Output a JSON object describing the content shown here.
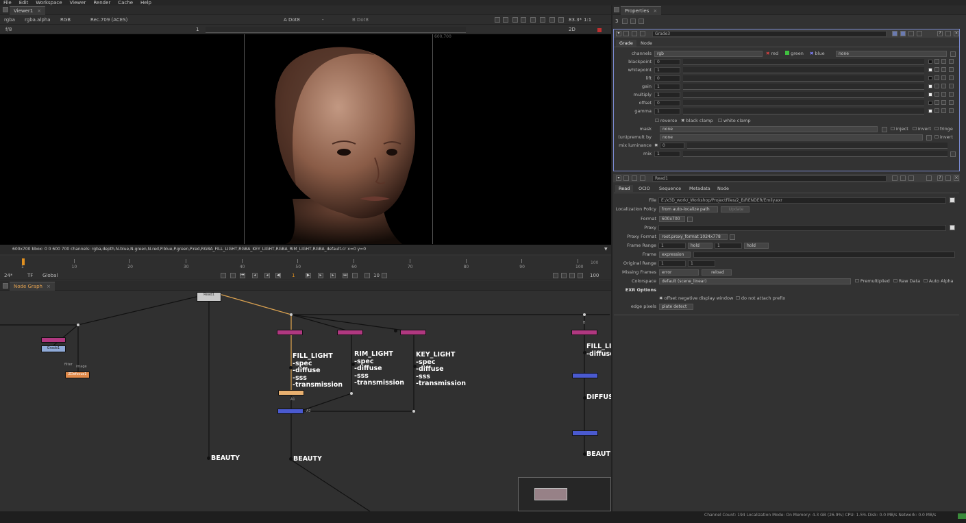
{
  "menu": [
    "File",
    "Edit",
    "Workspace",
    "Viewer",
    "Render",
    "Cache",
    "Help"
  ],
  "viewer": {
    "tab": "Viewer1",
    "layer": "rgba",
    "alpha": "rgba.alpha",
    "mode": "RGB",
    "colorspace": "Rec.709 (ACES)",
    "a_input": "A  Dot8",
    "a_dash": "-",
    "b_input": "B  Dot8",
    "zoom": "83.3*",
    "ratio": "1:1",
    "view": "2D",
    "fstop": "f/8",
    "frame": "1",
    "res_label": "600,700",
    "status": "600x700  bbox: 0 0 600 700 channels: rgba,depth,N.blue,N.green,N.red,P.blue,P.green,P.red,RGBA_FILL_LIGHT,RGBA_KEY_LIGHT,RGBA_RIM_LIGHT,RGBA_default.cr  x=0 y=0"
  },
  "timeline": {
    "ticks": [
      "1",
      "10",
      "20",
      "30",
      "40",
      "50",
      "60",
      "70",
      "80",
      "90",
      "100"
    ],
    "end": "100",
    "fps": "24*",
    "tf": "TF",
    "global": "Global",
    "current_frame": "1",
    "step": "10",
    "last": "100"
  },
  "nodegraph": {
    "tab": "Node Graph",
    "read_node": "Read1",
    "grade_node": "Grade1",
    "zdefocus": "ZDefocus1",
    "filter_label": "filter",
    "image_label": "image",
    "label_b": "B",
    "label_a1": "A1",
    "label_a2": "A2",
    "fill": "FILL_LIGHT\n-spec\n-diffuse\n-sss\n-transmission",
    "rim": "RIM_LIGHT\n-spec\n-diffuse\n-sss\n-transmission",
    "key": "KEY_LIGHT\n-spec\n-diffuse\n-sss\n-transmission",
    "fill_right": "FILL_LI\n-diffuse",
    "diffuse_right": "DIFFUS",
    "beauty1": "BEAUTY",
    "beauty2": "BEAUTY",
    "beauty3": "BEAUT"
  },
  "properties": {
    "tab": "Properties",
    "count": "3",
    "grade": {
      "name": "Grade3",
      "tabs": [
        "Grade",
        "Node"
      ],
      "channels": "rgb",
      "red": "red",
      "green": "green",
      "blue": "blue",
      "none": "none",
      "rows": [
        {
          "label": "blackpoint",
          "value": "0"
        },
        {
          "label": "whitepoint",
          "value": "1"
        },
        {
          "label": "lift",
          "value": "0"
        },
        {
          "label": "gain",
          "value": "1"
        },
        {
          "label": "multiply",
          "value": "1"
        },
        {
          "label": "offset",
          "value": "0"
        },
        {
          "label": "gamma",
          "value": "1"
        }
      ],
      "reverse": "reverse",
      "black_clamp": "black clamp",
      "white_clamp": "white clamp",
      "mask_label": "mask",
      "mask_value": "none",
      "inject": "inject",
      "invert": "invert",
      "fringe": "fringe",
      "unpremult_label": "(un)premult by",
      "unpremult_value": "none",
      "invert2": "invert",
      "mixlum_label": "mix luminance",
      "mixlum_value": "0",
      "mix_label": "mix",
      "mix_value": "1"
    },
    "read": {
      "name": "Read1",
      "tabs": [
        "Read",
        "OCIO",
        "Sequence",
        "Metadata",
        "Node"
      ],
      "file_label": "File",
      "file": "E:/x3D_work/_Workshop/ProjectFiles/2_B/RENDER/Emily.exr",
      "loc_label": "Localization Policy",
      "loc_value": "from auto-localize path",
      "update": "Update",
      "format_label": "Format",
      "format": "600x700",
      "proxy_label": "Proxy",
      "proxyformat_label": "Proxy Format",
      "proxyformat": "root.proxy_format 1024x778",
      "framerange_label": "Frame Range",
      "fr_start": "1",
      "fr_before": "hold",
      "fr_end": "1",
      "fr_after": "hold",
      "frame_label": "Frame",
      "frame": "expression",
      "orig_label": "Original Range",
      "orig_start": "1",
      "orig_end": "1",
      "missing_label": "Missing Frames",
      "missing": "error",
      "reload": "reload",
      "cs_label": "Colorspace",
      "cs": "default (scene_linear)",
      "premult": "Premultiplied",
      "rawdata": "Raw Data",
      "autoalpha": "Auto Alpha",
      "exr_label": "EXR Options",
      "offset_neg": "offset negative display window",
      "noprefix": "do not attach prefix",
      "edge_label": "edge pixels",
      "edge": "plate detect"
    }
  },
  "statusbar": "Channel Count: 194  Localization Mode: On  Memory: 4.3 GB (26.9%)  CPU: 1.5%  Disk: 0.0 MB/s  Network: 0.0 MB/s"
}
